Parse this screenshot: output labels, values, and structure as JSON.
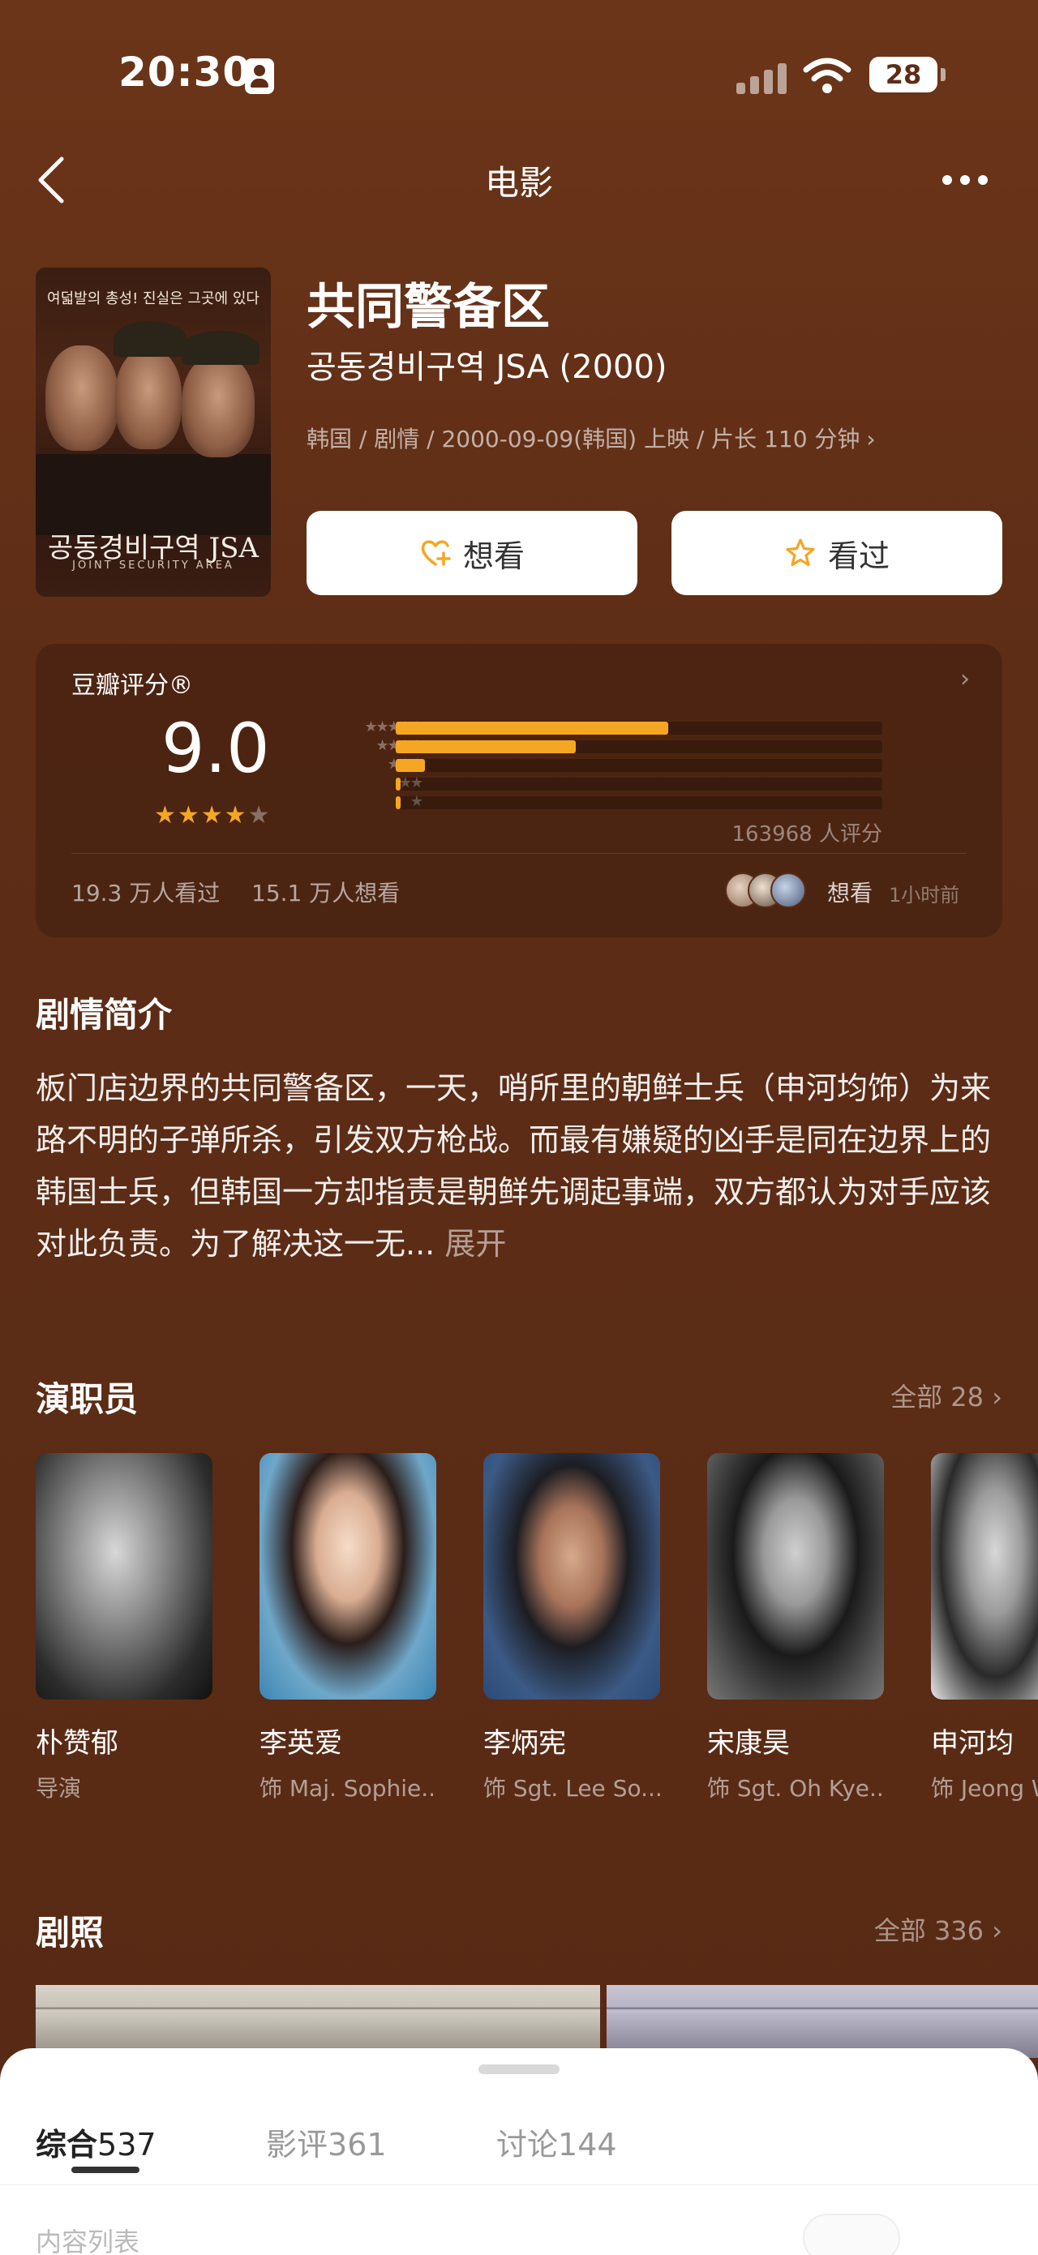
{
  "status_bar": {
    "time": "20:30",
    "battery": "28"
  },
  "nav": {
    "title": "电影"
  },
  "movie": {
    "title": "共同警备区",
    "original_title": "공동경비구역 JSA (2000)",
    "meta": "韩国 / 剧情 / 2000-09-09(韩国) 上映 / 片长 110 分钟",
    "poster": {
      "tagline": "여덟발의 총성! 진실은 그곳에 있다",
      "title": "공동경비구역 JSA",
      "subtitle": "JOINT SECURITY AREA"
    }
  },
  "actions": {
    "want": "想看",
    "seen": "看过"
  },
  "rating": {
    "brand": "豆瓣评分®",
    "score": "9.0",
    "stars": "★★★★",
    "half_star": "★",
    "distribution": [
      {
        "label": "★★★★★",
        "percent": 56
      },
      {
        "label": "★★★★",
        "percent": 37
      },
      {
        "label": "★★★",
        "percent": 6
      },
      {
        "label": "★★",
        "percent": 1
      },
      {
        "label": "★",
        "percent": 1
      }
    ],
    "count": "163968 人评分",
    "seen_count": "19.3 万人看过",
    "want_count": "15.1 万人想看",
    "activity": "想看",
    "activity_time": "1小时前"
  },
  "synopsis": {
    "title": "剧情简介",
    "text": "板门店边界的共同警备区，一天，哨所里的朝鲜士兵（申河均饰）为来路不明的子弹所杀，引发双方枪战。而最有嫌疑的凶手是同在边界上的韩国士兵，但韩国一方却指责是朝鲜先调起事端，双方都认为对手应该对此负责。为了解决这一无...",
    "expand": "展开"
  },
  "cast": {
    "title": "演职员",
    "more": "全部 28",
    "members": [
      {
        "name": "朴赞郁",
        "role": "导演"
      },
      {
        "name": "李英爱",
        "role": "饰 Maj. Sophie..."
      },
      {
        "name": "李炳宪",
        "role": "饰 Sgt. Lee So..."
      },
      {
        "name": "宋康昊",
        "role": "饰 Sgt. Oh Kye..."
      },
      {
        "name": "申河均",
        "role": "饰 Jeong W"
      }
    ]
  },
  "stills": {
    "title": "剧照",
    "more": "全部 336"
  },
  "bottom_sheet": {
    "tabs": [
      {
        "label": "综合",
        "count": "537"
      },
      {
        "label": "影评",
        "count": "361"
      },
      {
        "label": "讨论",
        "count": "144"
      }
    ],
    "section": "内容列表"
  },
  "colors": {
    "accent": "#f5a623",
    "background": "#5e2d16"
  }
}
